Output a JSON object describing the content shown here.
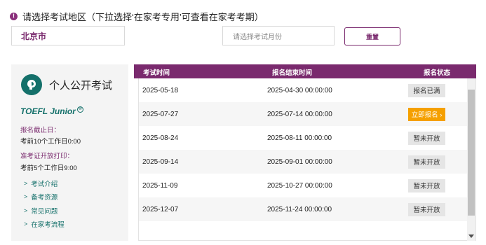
{
  "region": {
    "warning_glyph": "!",
    "prompt": "请选择考试地区（下拉选择‘在家考专用’可查看在家考考期）"
  },
  "filters": {
    "city_value": "北京市",
    "month_placeholder": "请选择考试月份",
    "reset_label": "重置"
  },
  "exam": {
    "title": "个人公开考试",
    "name": "TOEFL Junior",
    "reg_mark": "®",
    "deadline_label": "报名截止日：",
    "deadline_value": "考前10个工作日0:00",
    "ticket_label": "准考证开放打印：",
    "ticket_value": "考前5个工作日9:00",
    "links": [
      {
        "label": "考试介绍"
      },
      {
        "label": "备考资源"
      },
      {
        "label": "常见问题"
      },
      {
        "label": "在家考流程"
      }
    ]
  },
  "table": {
    "headers": {
      "date": "考试时间",
      "end": "报名结束时间",
      "status": "报名状态"
    },
    "rows": [
      {
        "date": "2025-05-18",
        "end": "2025-04-30 00:00:00",
        "status": "报名已满"
      },
      {
        "date": "2025-07-27",
        "end": "2025-07-14 00:00:00",
        "status": "立即报名 ›"
      },
      {
        "date": "2025-08-24",
        "end": "2025-08-11 00:00:00",
        "status": "暂未开放"
      },
      {
        "date": "2025-09-14",
        "end": "2025-09-01 00:00:00",
        "status": "暂未开放"
      },
      {
        "date": "2025-11-09",
        "end": "2025-10-27 00:00:00",
        "status": "暂未开放"
      },
      {
        "date": "2025-12-07",
        "end": "2025-11-24 00:00:00",
        "status": "暂未开放"
      }
    ]
  },
  "colors": {
    "brand_purple": "#7a2a6e",
    "teal": "#14706a",
    "open_orange": "#f5a000"
  }
}
